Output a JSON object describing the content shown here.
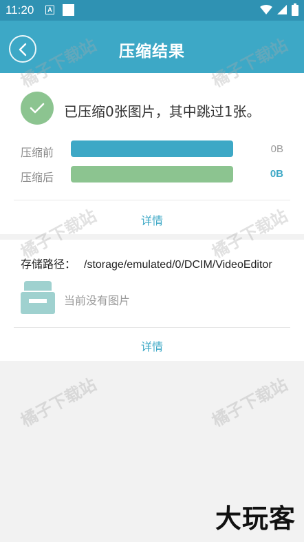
{
  "status_bar": {
    "time": "11:20",
    "notification_letter": "A",
    "icons": [
      "wifi-icon",
      "signal-icon",
      "battery-icon"
    ]
  },
  "app_bar": {
    "title": "压缩结果",
    "back_icon": "chevron-left-icon"
  },
  "result": {
    "summary": "已压缩0张图片，其中跳过1张。",
    "before_label": "压缩前",
    "before_value": "0B",
    "after_label": "压缩后",
    "after_value": "0B",
    "details_label": "详情"
  },
  "storage": {
    "path_label": "存储路径：",
    "path_value": "/storage/emulated/0/DCIM/VideoEditor",
    "empty_text": "当前没有图片",
    "details_label": "详情"
  },
  "watermark_text": "橘子下载站",
  "brand_text": "大玩客",
  "colors": {
    "status_bar": "#2f92b3",
    "app_bar": "#3da8c6",
    "accent_green": "#8cc490",
    "link": "#3da8c6"
  }
}
